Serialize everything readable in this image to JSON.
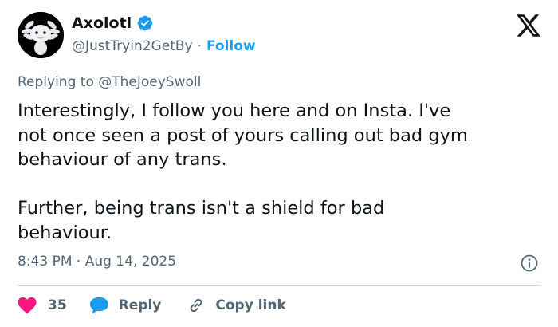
{
  "author": {
    "display_name": "Axolotl",
    "handle": "@JustTryin2GetBy",
    "separator": "·",
    "follow_label": "Follow"
  },
  "reply_context": {
    "prefix": "Replying to ",
    "mention": "@TheJoeySwoll"
  },
  "tweet": {
    "text": "Interestingly, I follow you here and on Insta. I've\nnot once seen a post of yours calling out bad gym\nbehaviour of any trans.\n\nFurther, being trans isn't a shield for bad\nbehaviour.",
    "timestamp": "8:43 PM · Aug 14, 2025"
  },
  "actions": {
    "like_count": "35",
    "reply_label": "Reply",
    "copy_label": "Copy link"
  },
  "colors": {
    "accent": "#1d9bf0",
    "like": "#f91880",
    "secondary_text": "#536471",
    "text": "#0f1419"
  },
  "icons": [
    "verified-badge-icon",
    "x-logo-icon",
    "info-icon",
    "heart-icon",
    "reply-bubble-icon",
    "link-icon"
  ]
}
